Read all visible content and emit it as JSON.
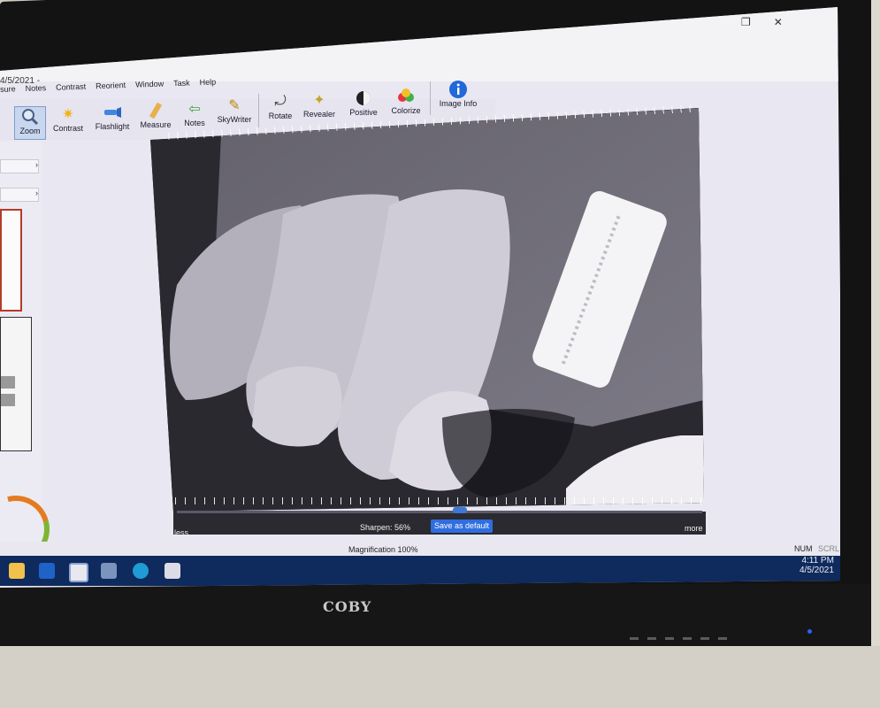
{
  "window": {
    "title": "4/5/2021 -",
    "controls": {
      "restore": "❐",
      "close": "✕"
    }
  },
  "menu": [
    "sure",
    "Notes",
    "Contrast",
    "Reorient",
    "Window",
    "Task",
    "Help"
  ],
  "toolbar": {
    "zoom": "Zoom",
    "contrast": "Contrast",
    "flashlight": "Flashlight",
    "measure": "Measure",
    "notes": "Notes",
    "skywriter": "SkyWriter",
    "rotate": "Rotate",
    "revealer": "Revealer",
    "positive": "Positive",
    "colorize": "Colorize",
    "image_info": "Image Info"
  },
  "side_panel": {
    "chevron": "›"
  },
  "image_panel": {
    "sharpen_label": "Sharpen: 56%",
    "sharpen_value": 56,
    "save_default": "Save as default",
    "less": "less",
    "more": "more"
  },
  "status": {
    "magnification": "Magnification 100%",
    "num": "NUM",
    "scrl": "SCRL"
  },
  "taskbar": {
    "time": "4:11 PM",
    "date": "4/5/2021"
  },
  "monitor": {
    "brand": "COBY"
  },
  "colors": {
    "accent": "#2f6de0",
    "taskbar": "#0f2a5c",
    "active_thumb_border": "#b43b2a"
  }
}
